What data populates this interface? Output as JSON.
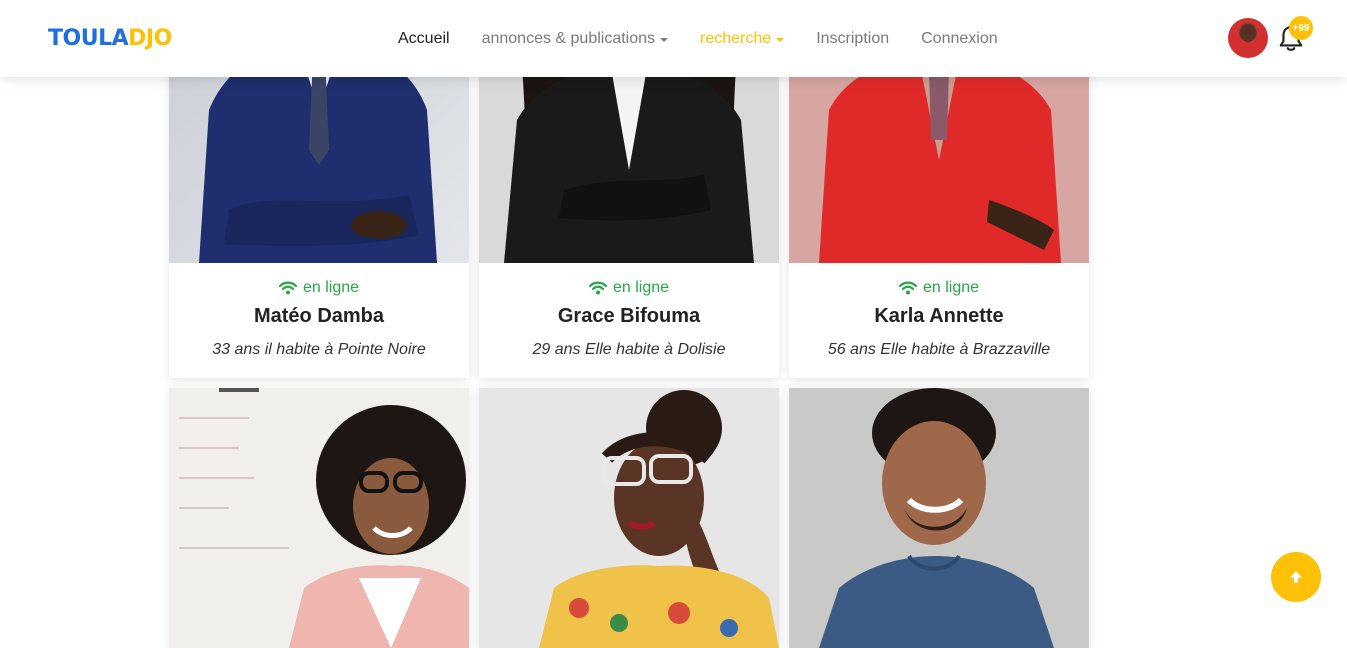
{
  "brand": {
    "part1": "TOULA",
    "part2": "DJO"
  },
  "nav": {
    "items": [
      {
        "label": "Accueil"
      },
      {
        "label": "annonces & publications"
      },
      {
        "label": "recherche"
      },
      {
        "label": "Inscription"
      },
      {
        "label": "Connexion"
      }
    ]
  },
  "notifications": {
    "count": "+99"
  },
  "profiles": [
    {
      "status": "en ligne",
      "name": "Matéo Damba",
      "desc": "33 ans il habite à Pointe Noire"
    },
    {
      "status": "en ligne",
      "name": "Grace Bifouma",
      "desc": "29 ans Elle habite à Dolisie"
    },
    {
      "status": "en ligne",
      "name": "Karla Annette",
      "desc": "56 ans Elle habite à Brazzaville"
    }
  ],
  "colors": {
    "brand_blue": "#1e6fe0",
    "accent": "#ffc107",
    "online": "#28a745"
  }
}
